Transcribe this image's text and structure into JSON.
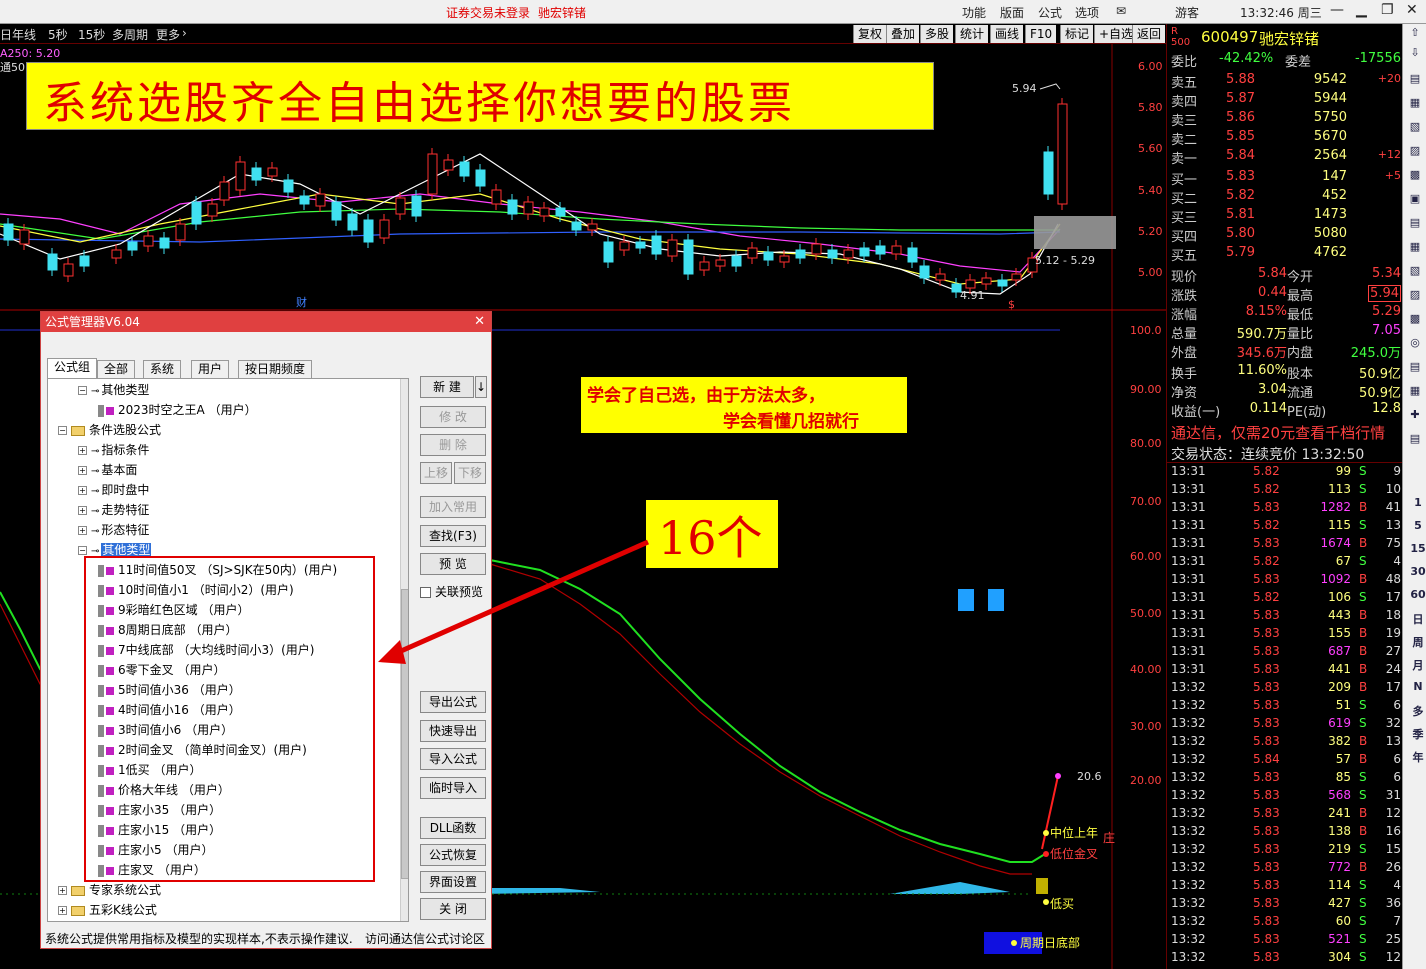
{
  "topbar": {
    "warning": "证券交易未登录",
    "stock_name": "驰宏锌锗",
    "menu": [
      "功能",
      "版面",
      "公式",
      "选项"
    ],
    "user": "游客",
    "clock": "13:32:46 周三"
  },
  "toolbar": {
    "left_items": [
      "年线",
      "5秒",
      "15秒",
      "多周期",
      "更多"
    ],
    "right_items": [
      "复权",
      "叠加",
      "多股",
      "统计",
      "画线",
      "F10",
      "标记",
      "+自选",
      "返回"
    ],
    "ma_label": "A250: 5.20",
    "tong_label": "通50"
  },
  "banner": {
    "text": "系统选股齐全自由选择你想要的股票"
  },
  "note": {
    "line1": "学会了自己选，由于方法太多，",
    "line2": "学会看懂几招就行"
  },
  "callout": {
    "text": "16个"
  },
  "price_axis": [
    "6.00",
    "5.80",
    "5.60",
    "5.40",
    "5.20",
    "5.00"
  ],
  "price_annotations": {
    "high": "5.94",
    "low": "4.91",
    "range": "5.12 - 5.29",
    "cai": "财",
    "s": "$"
  },
  "indicator_axis": [
    "100.0",
    "90.00",
    "80.00",
    "70.00",
    "60.00",
    "50.00",
    "40.00",
    "30.00",
    "20.00"
  ],
  "indicator_labels": {
    "value": "20.6",
    "zhongwei": "中位上年",
    "diwei": "低位金叉",
    "dimai": "低买",
    "zhouqi": "周期日底部",
    "zhuang": "庄"
  },
  "dialog": {
    "title": "公式管理器V6.04",
    "tabs": [
      "公式组",
      "全部",
      "系统",
      "用户",
      "按日期频度"
    ],
    "tree": [
      {
        "type": "key",
        "label": "其他类型",
        "indent": 1
      },
      {
        "type": "doc",
        "label": "2023时空之王A （用户）",
        "indent": 2
      },
      {
        "type": "folder",
        "label": "条件选股公式",
        "indent": 0
      },
      {
        "type": "key",
        "label": "指标条件",
        "indent": 1
      },
      {
        "type": "key",
        "label": "基本面",
        "indent": 1
      },
      {
        "type": "key",
        "label": "即时盘中",
        "indent": 1
      },
      {
        "type": "key",
        "label": "走势特征",
        "indent": 1
      },
      {
        "type": "key",
        "label": "形态特征",
        "indent": 1
      },
      {
        "type": "keysel",
        "label": "其他类型",
        "indent": 1
      },
      {
        "type": "doc",
        "label": "11时间值50叉 （SJ>SJK在50内）(用户)",
        "indent": 2
      },
      {
        "type": "doc",
        "label": "10时间值小1 （时间小2）(用户)",
        "indent": 2
      },
      {
        "type": "doc",
        "label": "9彩暗红色区域 （用户）",
        "indent": 2
      },
      {
        "type": "doc",
        "label": "8周期日底部 （用户）",
        "indent": 2
      },
      {
        "type": "doc",
        "label": "7中线底部 （大均线时间小3）(用户)",
        "indent": 2
      },
      {
        "type": "doc",
        "label": "6零下金叉 （用户）",
        "indent": 2
      },
      {
        "type": "doc",
        "label": "5时间值小36 （用户）",
        "indent": 2
      },
      {
        "type": "doc",
        "label": "4时间值小16 （用户）",
        "indent": 2
      },
      {
        "type": "doc",
        "label": "3时间值小6 （用户）",
        "indent": 2
      },
      {
        "type": "doc",
        "label": "2时间金叉 （简单时间金叉）(用户)",
        "indent": 2
      },
      {
        "type": "doc",
        "label": "1低买 （用户）",
        "indent": 2
      },
      {
        "type": "doc",
        "label": "价格大年线 （用户）",
        "indent": 2
      },
      {
        "type": "doc",
        "label": "庄家小35 （用户）",
        "indent": 2
      },
      {
        "type": "doc",
        "label": "庄家小15 （用户）",
        "indent": 2
      },
      {
        "type": "doc",
        "label": "庄家小5 （用户）",
        "indent": 2
      },
      {
        "type": "doc",
        "label": "庄家叉 （用户）",
        "indent": 2
      },
      {
        "type": "folder",
        "label": "专家系统公式",
        "indent": 0
      },
      {
        "type": "folder",
        "label": "五彩K线公式",
        "indent": 0
      }
    ],
    "buttons": {
      "new": "新 建",
      "modify": "修 改",
      "delete": "删 除",
      "up": "上移",
      "down": "下移",
      "add_common": "加入常用",
      "find": "查找(F3)",
      "preview": "预 览",
      "link_preview": "关联预览",
      "export": "导出公式",
      "quick_export": "快速导出",
      "import": "导入公式",
      "temp_import": "临时导入",
      "dll": "DLL函数",
      "restore": "公式恢复",
      "ui_setting": "界面设置",
      "close": "关 闭"
    },
    "footer_left": "系统公式提供常用指标及模型的实现样本,不表示操作建议.",
    "footer_right": "访问通达信公式讨论区"
  },
  "quote": {
    "code": "600497",
    "name": "驰宏锌锗",
    "weibi_label": "委比",
    "weibi": "-42.42%",
    "weicha_label": "委差",
    "weicha": "-17556",
    "asks": [
      {
        "label": "卖五",
        "price": "5.88",
        "vol": "9542",
        "chg": "+20"
      },
      {
        "label": "卖四",
        "price": "5.87",
        "vol": "5944",
        "chg": ""
      },
      {
        "label": "卖三",
        "price": "5.86",
        "vol": "5750",
        "chg": ""
      },
      {
        "label": "卖二",
        "price": "5.85",
        "vol": "5670",
        "chg": ""
      },
      {
        "label": "卖一",
        "price": "5.84",
        "vol": "2564",
        "chg": "+12"
      }
    ],
    "bids": [
      {
        "label": "买一",
        "price": "5.83",
        "vol": "147",
        "chg": "+5"
      },
      {
        "label": "买二",
        "price": "5.82",
        "vol": "452",
        "chg": ""
      },
      {
        "label": "买三",
        "price": "5.81",
        "vol": "1473",
        "chg": ""
      },
      {
        "label": "买四",
        "price": "5.80",
        "vol": "5080",
        "chg": ""
      },
      {
        "label": "买五",
        "price": "5.79",
        "vol": "4762",
        "chg": ""
      }
    ],
    "stats": [
      {
        "l1": "现价",
        "v1": "5.84",
        "l2": "今开",
        "v2": "5.34"
      },
      {
        "l1": "涨跌",
        "v1": "0.44",
        "l2": "最高",
        "v2": "5.94"
      },
      {
        "l1": "涨幅",
        "v1": "8.15%",
        "l2": "最低",
        "v2": "5.29"
      },
      {
        "l1": "总量",
        "v1": "590.7万",
        "l2": "量比",
        "v2": "7.05"
      },
      {
        "l1": "外盘",
        "v1": "345.6万",
        "l2": "内盘",
        "v2": "245.0万"
      },
      {
        "l1": "换手",
        "v1": "11.60%",
        "l2": "股本",
        "v2": "50.9亿"
      },
      {
        "l1": "净资",
        "v1": "3.04",
        "l2": "流通",
        "v2": "50.9亿"
      },
      {
        "l1": "收益(一)",
        "v1": "0.114",
        "l2": "PE(动)",
        "v2": "12.8"
      }
    ],
    "ad": "通达信，仅需20元查看千档行情",
    "status": "交易状态：连续竞价 13:32:50"
  },
  "ticks": [
    [
      "13:31",
      "5.82",
      "99",
      "S",
      "9"
    ],
    [
      "13:31",
      "5.82",
      "113",
      "S",
      "10"
    ],
    [
      "13:31",
      "5.83",
      "1282",
      "B",
      "41"
    ],
    [
      "13:31",
      "5.82",
      "115",
      "S",
      "13"
    ],
    [
      "13:31",
      "5.83",
      "1674",
      "B",
      "75"
    ],
    [
      "13:31",
      "5.82",
      "67",
      "S",
      "4"
    ],
    [
      "13:31",
      "5.83",
      "1092",
      "B",
      "48"
    ],
    [
      "13:31",
      "5.82",
      "106",
      "S",
      "17"
    ],
    [
      "13:31",
      "5.83",
      "443",
      "B",
      "18"
    ],
    [
      "13:31",
      "5.83",
      "155",
      "B",
      "19"
    ],
    [
      "13:31",
      "5.83",
      "687",
      "B",
      "27"
    ],
    [
      "13:31",
      "5.83",
      "441",
      "B",
      "24"
    ],
    [
      "13:32",
      "5.83",
      "209",
      "B",
      "17"
    ],
    [
      "13:32",
      "5.83",
      "51",
      "S",
      "6"
    ],
    [
      "13:32",
      "5.83",
      "619",
      "S",
      "32"
    ],
    [
      "13:32",
      "5.83",
      "382",
      "B",
      "13"
    ],
    [
      "13:32",
      "5.84",
      "57",
      "B",
      "6"
    ],
    [
      "13:32",
      "5.83",
      "85",
      "S",
      "6"
    ],
    [
      "13:32",
      "5.83",
      "568",
      "S",
      "31"
    ],
    [
      "13:32",
      "5.83",
      "241",
      "B",
      "12"
    ],
    [
      "13:32",
      "5.83",
      "138",
      "B",
      "16"
    ],
    [
      "13:32",
      "5.83",
      "219",
      "S",
      "15"
    ],
    [
      "13:32",
      "5.83",
      "772",
      "B",
      "26"
    ],
    [
      "13:32",
      "5.83",
      "114",
      "S",
      "4"
    ],
    [
      "13:32",
      "5.83",
      "427",
      "S",
      "36"
    ],
    [
      "13:32",
      "5.83",
      "60",
      "S",
      "7"
    ],
    [
      "13:32",
      "5.83",
      "521",
      "S",
      "25"
    ],
    [
      "13:32",
      "5.83",
      "304",
      "S",
      "12"
    ]
  ],
  "sidebar": [
    "1",
    "5",
    "15",
    "30",
    "60",
    "日",
    "周",
    "月",
    "N",
    "多",
    "季",
    "年"
  ],
  "colors": {
    "up": "#ff3030",
    "down": "#40e0f0",
    "ma5": "#ffffff",
    "ma10": "#ffff40",
    "ma20": "#ff40ff",
    "ma60": "#40ff40",
    "indicator_green": "#20e020",
    "indicator_red": "#c00000"
  }
}
